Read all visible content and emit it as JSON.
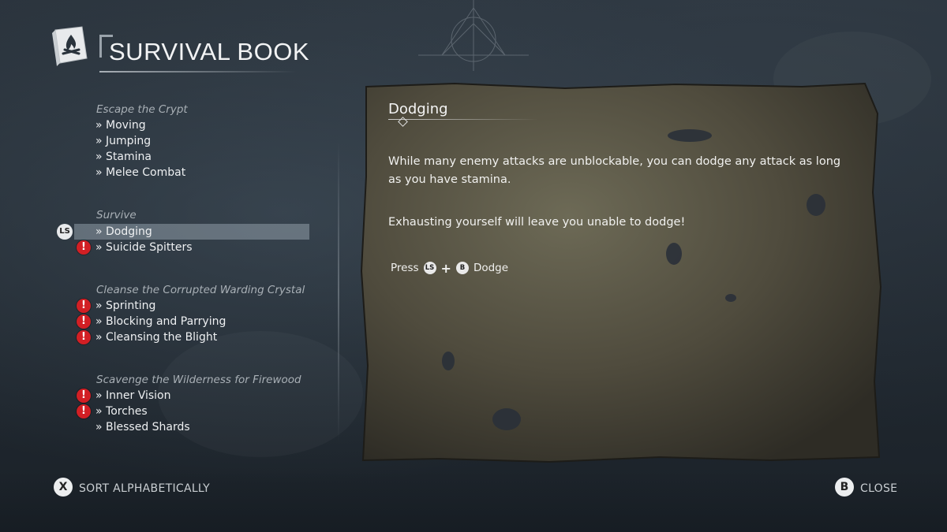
{
  "header": {
    "title": "SURVIVAL BOOK",
    "icon": "campfire-book-icon"
  },
  "sections": [
    {
      "title": "Escape the Crypt",
      "items": [
        {
          "label": "» Moving",
          "alert": false
        },
        {
          "label": "» Jumping",
          "alert": false
        },
        {
          "label": "» Stamina",
          "alert": false
        },
        {
          "label": "» Melee Combat",
          "alert": false
        }
      ]
    },
    {
      "title": "Survive",
      "items": [
        {
          "label": "» Dodging",
          "alert": false,
          "selected": true
        },
        {
          "label": "» Suicide Spitters",
          "alert": true
        }
      ]
    },
    {
      "title": "Cleanse the Corrupted Warding Crystal",
      "items": [
        {
          "label": "» Sprinting",
          "alert": true
        },
        {
          "label": "» Blocking and Parrying",
          "alert": true
        },
        {
          "label": "» Cleansing the Blight",
          "alert": true
        }
      ]
    },
    {
      "title": "Scavenge the Wilderness for Firewood",
      "items": [
        {
          "label": "» Inner Vision",
          "alert": true
        },
        {
          "label": "» Torches",
          "alert": true
        },
        {
          "label": "» Blessed Shards",
          "alert": false
        }
      ]
    }
  ],
  "selector_badge": "LS",
  "alert_glyph": "!",
  "entry": {
    "title": "Dodging",
    "paragraphs": [
      "While many enemy attacks are unblockable, you can dodge any attack as long as you have stamina.",
      "Exhausting yourself will leave you unable to dodge!"
    ],
    "control": {
      "press": "Press",
      "button1": "LS",
      "plus": "+",
      "button2": "B",
      "action": "Dodge"
    }
  },
  "footer": {
    "sort": {
      "button": "X",
      "label": "SORT ALPHABETICALLY"
    },
    "close": {
      "button": "B",
      "label": "CLOSE"
    }
  },
  "colors": {
    "alert": "#d21f24",
    "selected_row": "#a5b2bc",
    "parchment": "#5b5646"
  }
}
